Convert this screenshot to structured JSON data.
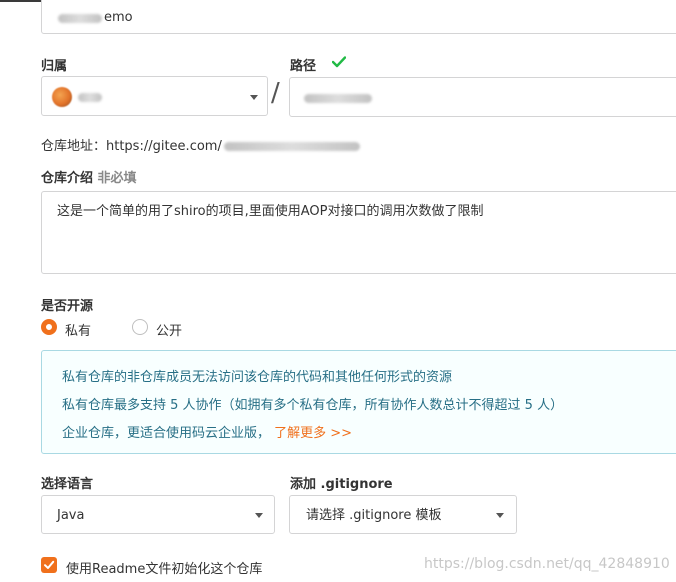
{
  "repo_name": {
    "value_suffix": "emo"
  },
  "owner": {
    "label": "归属"
  },
  "path": {
    "label": "路径"
  },
  "separator": "/",
  "repo_url": {
    "label": "仓库地址：https://gitee.com/"
  },
  "description": {
    "label": "仓库介绍",
    "optional_tag": "非必填",
    "value": "这是一个简单的用了shiro的项目,里面使用AOP对接口的调用次数做了限制"
  },
  "open_source": {
    "label": "是否开源",
    "options": [
      {
        "label": "私有",
        "selected": true
      },
      {
        "label": "公开",
        "selected": false
      }
    ]
  },
  "notice": {
    "line1": "私有仓库的非仓库成员无法访问该仓库的代码和其他任何形式的资源",
    "line2": "私有仓库最多支持 5 人协作（如拥有多个私有仓库，所有协作人数总计不得超过 5 人）",
    "line3": "企业仓库，更适合使用码云企业版，",
    "link": "了解更多 >>"
  },
  "language": {
    "label": "选择语言",
    "selected": "Java"
  },
  "gitignore": {
    "label": "添加 .gitignore",
    "selected": "请选择 .gitignore 模板"
  },
  "readme": {
    "label": "使用Readme文件初始化这个仓库",
    "checked": true
  },
  "watermark": "https://blog.csdn.net/qq_42848910",
  "colors": {
    "accent": "#f0701c",
    "success_check": "#21ba45",
    "notice_text": "#276f86",
    "notice_border": "#a9d9e3"
  }
}
